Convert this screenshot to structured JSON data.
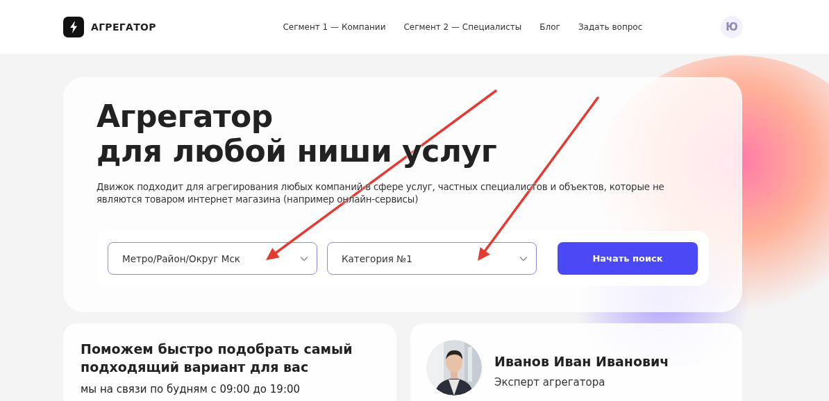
{
  "header": {
    "logo_text": "АГРЕГАТОР",
    "nav": [
      {
        "label": "Сегмент 1 — Компании"
      },
      {
        "label": "Сегмент 2 — Специалисты"
      },
      {
        "label": "Блог"
      },
      {
        "label": "Задать вопрос"
      }
    ],
    "avatar_letter": "Ю"
  },
  "hero": {
    "title_lines": [
      "Агрегатор",
      "для любой ниши услуг"
    ],
    "description": "Движок подходит для агрегирования любых компаний в сфере услуг, частных специалистов и объектов, которые не являются товаром интернет магазина (например онлайн-сервисы)",
    "search": {
      "selects": [
        {
          "value": "Метро/Район/Округ Мск"
        },
        {
          "value": "Категория №1"
        }
      ],
      "button": "Начать поиск"
    }
  },
  "help_card": {
    "title": "Поможем быстро подобрать самый подходящий вариант для вас",
    "hours": "мы на связи по будням с 09:00 до 19:00"
  },
  "expert_card": {
    "name": "Иванов Иван Иванович",
    "role": "Эксперт агрегатора"
  },
  "annotations": [
    {
      "kind": "arrow"
    },
    {
      "kind": "arrow"
    }
  ]
}
